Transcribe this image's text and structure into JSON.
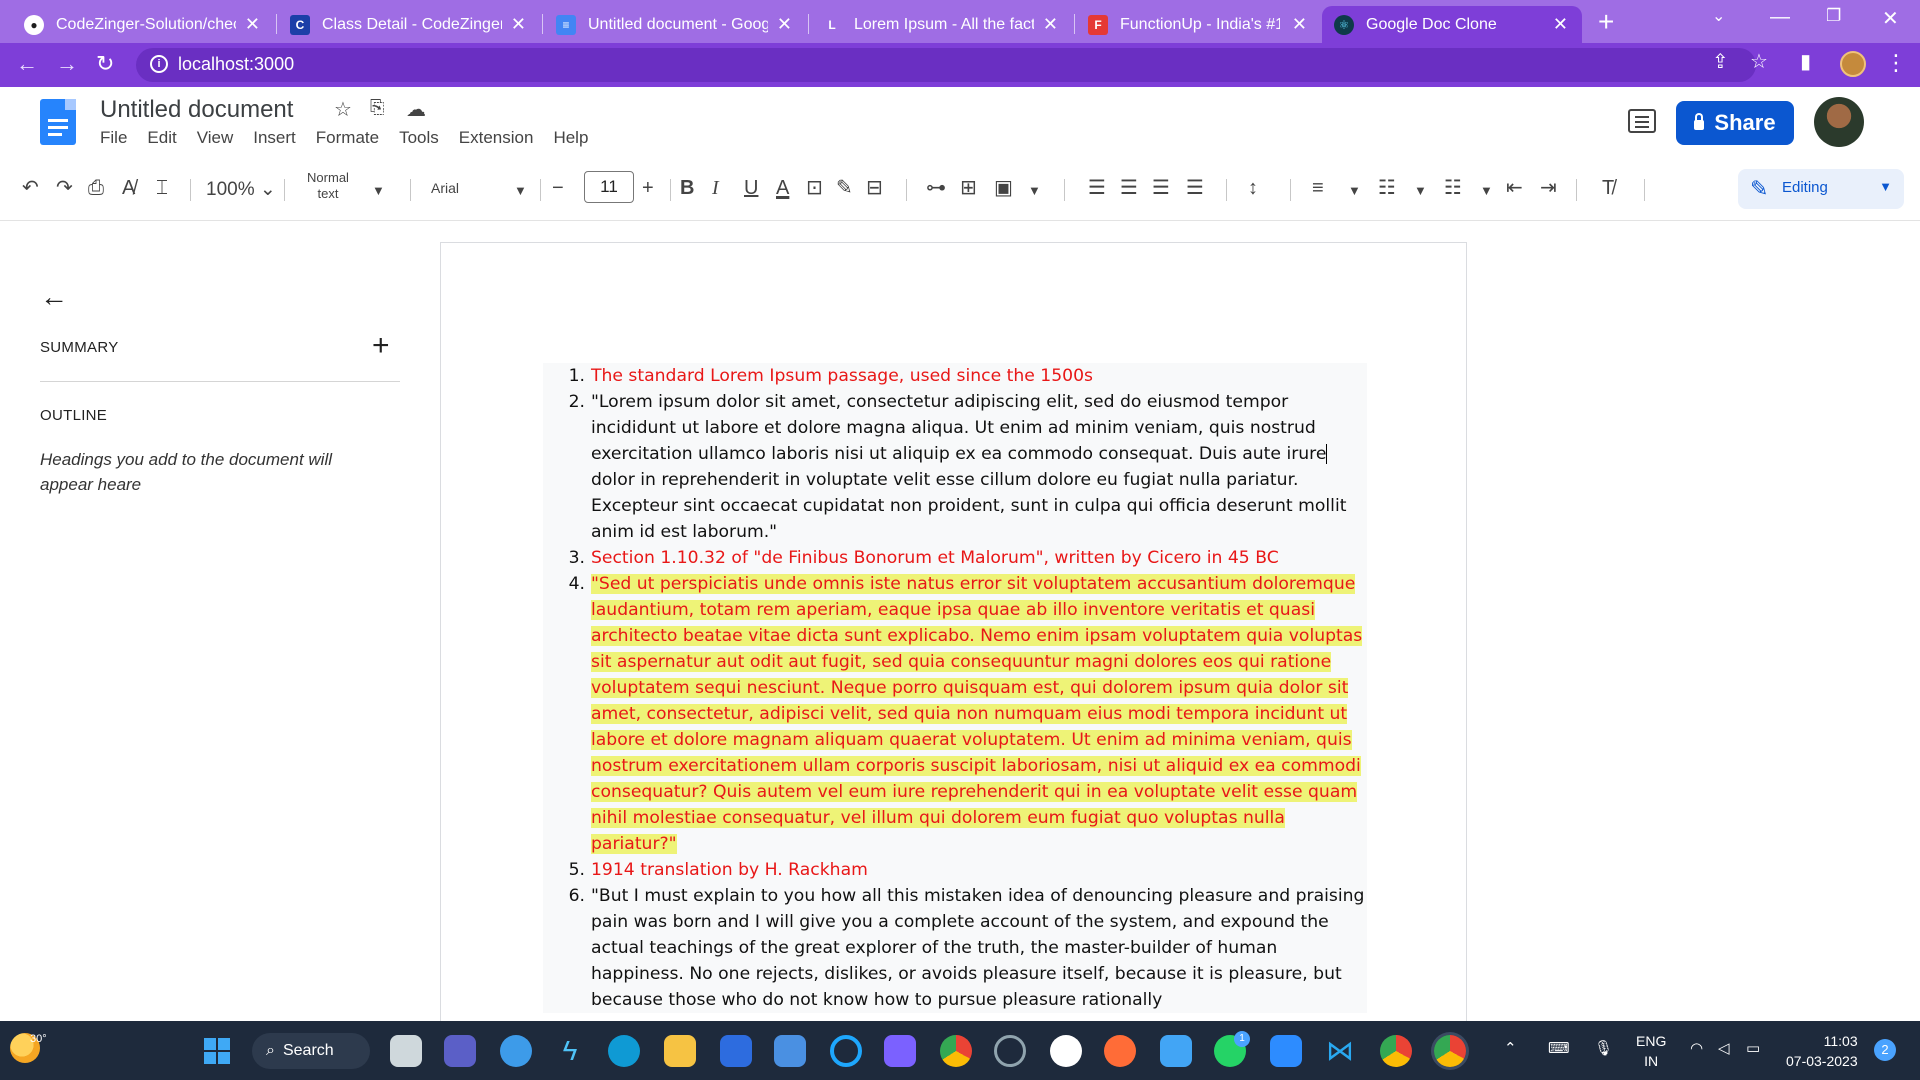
{
  "browser": {
    "tabs": [
      {
        "title": "CodeZinger-Solution/check",
        "icon": "github-icon"
      },
      {
        "title": "Class Detail - CodeZinger",
        "icon": "codezinger-icon"
      },
      {
        "title": "Untitled document - Google",
        "icon": "google-docs-icon"
      },
      {
        "title": "Lorem Ipsum - All the facts",
        "icon": "lorem-ipsum-icon"
      },
      {
        "title": "FunctionUp - India's #1 Pla",
        "icon": "functionup-icon"
      },
      {
        "title": "Google Doc Clone",
        "icon": "react-icon",
        "active": true
      }
    ],
    "url": "localhost:3000",
    "accent_color": "#7e3ed8"
  },
  "docs": {
    "title": "Untitled document",
    "menu": [
      "File",
      "Edit",
      "View",
      "Insert",
      "Formate",
      "Tools",
      "Extension",
      "Help"
    ],
    "share_label": "Share",
    "share_color": "#0b57d0"
  },
  "toolbar": {
    "zoom": "100%",
    "style_line1": "Normal",
    "style_line2": "text",
    "font": "Arial",
    "size_minus": "−",
    "font_size": "11",
    "size_plus": "+",
    "bold": "B",
    "italic": "I",
    "underline": "U",
    "text_color": "A",
    "mode": "Editing"
  },
  "sidebar": {
    "summary": "SUMMARY",
    "outline": "OUTLINE",
    "outline_hint": "Headings you add to the document will appear heare"
  },
  "document": {
    "items": [
      {
        "num": "1.",
        "text": "The standard Lorem Ipsum passage, used since the 1500s"
      },
      {
        "num": "2.",
        "text_before_caret": "\"Lorem ipsum dolor sit amet, consectetur adipiscing elit, sed do eiusmod tempor incididunt ut labore et dolore magna aliqua. Ut enim ad minim veniam, quis nostrud exercitation ullamco laboris nisi ut aliquip ex ea commodo consequat. Duis aute irure",
        "text_after_caret": " dolor in reprehenderit in voluptate velit esse cillum dolore eu fugiat nulla pariatur. Excepteur sint occaecat cupidatat non proident, sunt in culpa qui officia deserunt mollit anim id est laborum.\""
      },
      {
        "num": "3.",
        "text": "Section 1.10.32 of \"de Finibus Bonorum et Malorum\", written by Cicero in 45 BC"
      },
      {
        "num": "4.",
        "text": "\"Sed ut perspiciatis unde omnis iste natus error sit voluptatem accusantium doloremque laudantium, totam rem aperiam, eaque ipsa quae ab illo inventore veritatis et quasi architecto beatae vitae dicta sunt explicabo. Nemo enim ipsam voluptatem quia voluptas sit aspernatur aut odit aut fugit, sed quia consequuntur magni dolores eos qui ratione voluptatem sequi nesciunt. Neque porro quisquam est, qui dolorem ipsum quia dolor sit amet, consectetur, adipisci velit, sed quia non numquam eius modi tempora incidunt ut labore et dolore magnam aliquam quaerat voluptatem. Ut enim ad minima veniam, quis nostrum exercitationem ullam corporis suscipit laboriosam, nisi ut aliquid ex ea commodi consequatur? Quis autem vel eum iure reprehenderit qui in ea voluptate velit esse quam nihil molestiae consequatur, vel illum qui dolorem eum fugiat quo voluptas nulla pariatur?\""
      },
      {
        "num": "5.",
        "text": "1914 translation by H. Rackham"
      },
      {
        "num": "6.",
        "text": "\"But I must explain to you how all this mistaken idea of denouncing pleasure and praising pain was born and I will give you a complete account of the system, and expound the actual teachings of the great explorer of the truth, the master-builder of human happiness. No one rejects, dislikes, or avoids pleasure itself, because it is pleasure, but because those who do not know how to pursue pleasure rationally"
      }
    ],
    "red_color": "#e81717",
    "highlight_color": "#eef377"
  },
  "taskbar": {
    "temperature": "30°",
    "search_label": "Search",
    "lang_line1": "ENG",
    "lang_line2": "IN",
    "time": "11:03",
    "date": "07-03-2023",
    "notifications": "2",
    "whatsapp_badge": "1"
  }
}
